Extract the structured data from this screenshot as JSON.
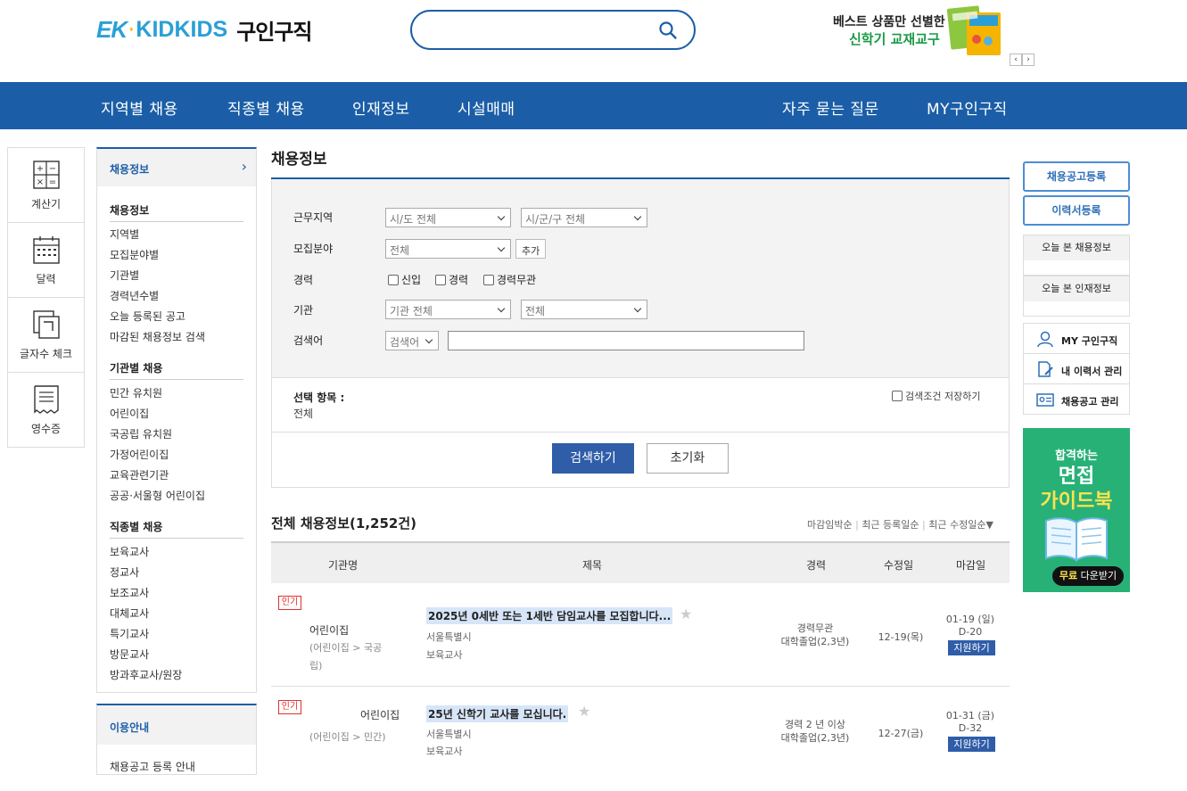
{
  "header": {
    "logo_ek": "EK",
    "logo_kidkids": "KIDKIDS",
    "logo_sub": "구인구직",
    "search_placeholder": "",
    "banner_line1": "베스트 상품만 선별한",
    "banner_line2": "신학기 교재교구",
    "banner_prev": "‹",
    "banner_next": "›"
  },
  "nav": {
    "items": [
      "지역별 채용",
      "직종별 채용",
      "인재정보",
      "시설매매",
      "자주 묻는 질문",
      "MY구인구직"
    ]
  },
  "quick_tools": [
    {
      "label": "계산기",
      "icon": "calculator-icon"
    },
    {
      "label": "달력",
      "icon": "calendar-icon"
    },
    {
      "label": "글자수 체크",
      "icon": "copy-icon"
    },
    {
      "label": "영수증",
      "icon": "receipt-icon"
    }
  ],
  "lnb": {
    "head": "채용정보",
    "head_arrow": "›",
    "sections": [
      {
        "title": "채용정보",
        "links": [
          "지역별",
          "모집분야별",
          "기관별",
          "경력년수별",
          "오늘 등록된 공고",
          "마감된 채용정보 검색"
        ]
      },
      {
        "title": "기관별 채용",
        "links": [
          "민간 유치원",
          "어린이집",
          "국공립 유치원",
          "가정어린이집",
          "교육관련기관",
          "공공·서울형 어린이집"
        ]
      },
      {
        "title": "직종별 채용",
        "links": [
          "보육교사",
          "정교사",
          "보조교사",
          "대체교사",
          "특기교사",
          "방문교사",
          "방과후교사/원장"
        ]
      }
    ],
    "guide_head": "이용안내",
    "guide_links": [
      "채용공고 등록 안내"
    ]
  },
  "main": {
    "title": "채용정보",
    "filter": {
      "region_label": "근무지역",
      "region_sido": "시/도 전체",
      "region_gugun": "시/군/구 전체",
      "field_label": "모집분야",
      "field_value": "전체",
      "add_label": "추가",
      "career_label": "경력",
      "career_options": [
        "신입",
        "경력",
        "경력무관"
      ],
      "org_label": "기관",
      "org_value": "기관 전체",
      "org_value2": "전체",
      "keyword_label": "검색어",
      "keyword_select": "검색어",
      "keyword_value": ""
    },
    "selected_label": "선택 항목 :",
    "selected_value": "전체",
    "save_condition": "검색조건 저장하기",
    "search_btn": "검색하기",
    "reset_btn": "초기화",
    "list_title": "전체 채용정보(1,252건)",
    "sort_options": [
      "마감임박순",
      "최근 등록일순",
      "최근 수정일순▼"
    ],
    "columns": [
      "기관명",
      "제목",
      "경력",
      "수정일",
      "마감일"
    ],
    "rows": [
      {
        "badge": "인기",
        "org": "어린이집",
        "org_type": "(어린이집 > 국공립)",
        "title": "2025년 0세반 또는 1세반 담임교사를 모집합니다...",
        "location": "서울특별시 ",
        "category": "보육교사",
        "career": "경력무관",
        "education": "대학졸업(2,3년)",
        "modified": "12-19(목)",
        "deadline": "01-19 (일)",
        "dday": "D-20",
        "apply": "지원하기"
      },
      {
        "badge": "인기",
        "org": "어린이집",
        "org_type": "(어린이집 > 민간)",
        "title": "25년 신학기 교사를 모십니다.",
        "location": "서울특별시 ",
        "category": "보육교사",
        "career": "경력 2 년 이상",
        "education": "대학졸업(2,3년)",
        "modified": "12-27(금)",
        "deadline": "01-31 (금)",
        "dday": "D-32",
        "apply": "지원하기"
      }
    ]
  },
  "right": {
    "post_job": "채용공고등록",
    "post_resume": "이력서등록",
    "today_jobs": "오늘 본 채용정보",
    "today_talent": "오늘 본 인재정보",
    "my_items": [
      {
        "label": "MY 구인구직",
        "icon": "user-icon"
      },
      {
        "label": "내 이력서 관리",
        "icon": "document-edit-icon"
      },
      {
        "label": "채용공고 관리",
        "icon": "id-card-icon"
      }
    ],
    "guide_line1": "합격하는",
    "guide_line2": "면접",
    "guide_line3": "가이드북",
    "guide_free": "무료",
    "guide_download": " 다운받기"
  },
  "colors": {
    "primary": "#1b5ea7",
    "button": "#2f5da8",
    "badge": "#e0312f",
    "guide_bg": "#27b177"
  }
}
